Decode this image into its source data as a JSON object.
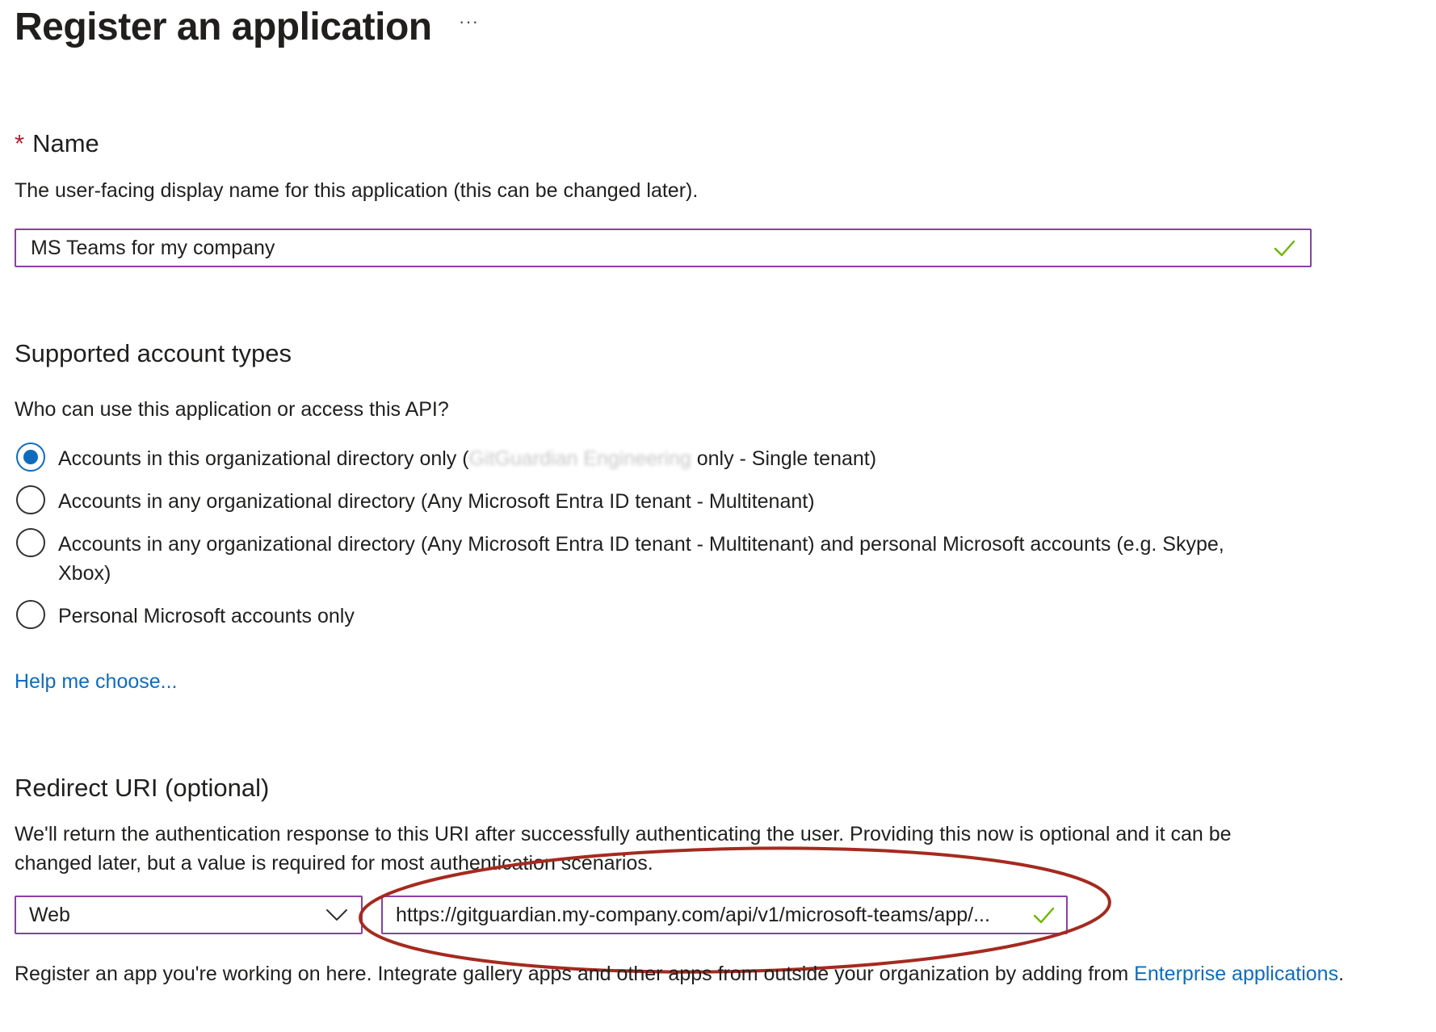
{
  "header": {
    "title": "Register an application",
    "more": "···"
  },
  "name_section": {
    "required_mark": "*",
    "label": "Name",
    "description": "The user-facing display name for this application (this can be changed later).",
    "value": "MS Teams for my company"
  },
  "account_types": {
    "title": "Supported account types",
    "question": "Who can use this application or access this API?",
    "options": [
      {
        "text_before": "Accounts in this organizational directory only (",
        "redacted": "GitGuardian Engineering",
        "text_after": " only - Single tenant)",
        "selected": true
      },
      {
        "label": "Accounts in any organizational directory (Any Microsoft Entra ID tenant - Multitenant)",
        "selected": false
      },
      {
        "label_line1": "Accounts in any organizational directory (Any Microsoft Entra ID tenant - Multitenant) and personal Microsoft accounts (e.g. Skype,",
        "label_line2": "Xbox)",
        "selected": false
      },
      {
        "label": "Personal Microsoft accounts only",
        "selected": false
      }
    ],
    "help_link": "Help me choose..."
  },
  "redirect": {
    "title": "Redirect URI (optional)",
    "description_line1": "We'll return the authentication response to this URI after successfully authenticating the user. Providing this now is optional and it can be",
    "description_line2": "changed later, but a value is required for most authentication scenarios.",
    "platform": "Web",
    "uri": "https://gitguardian.my-company.com/api/v1/microsoft-teams/app/..."
  },
  "footer": {
    "text": "Register an app you're working on here. Integrate gallery apps and other apps from outside your organization by adding from ",
    "link": "Enterprise applications",
    "end": "."
  },
  "colors": {
    "accent": "#0f6cbd",
    "border": "#8a3fa6",
    "check": "#6bb700",
    "annotation": "#a52a1f",
    "required": "#a4262c"
  },
  "icons": {
    "valid": "checkmark-icon",
    "dropdown": "chevron-down-icon",
    "more": "ellipsis-icon"
  }
}
